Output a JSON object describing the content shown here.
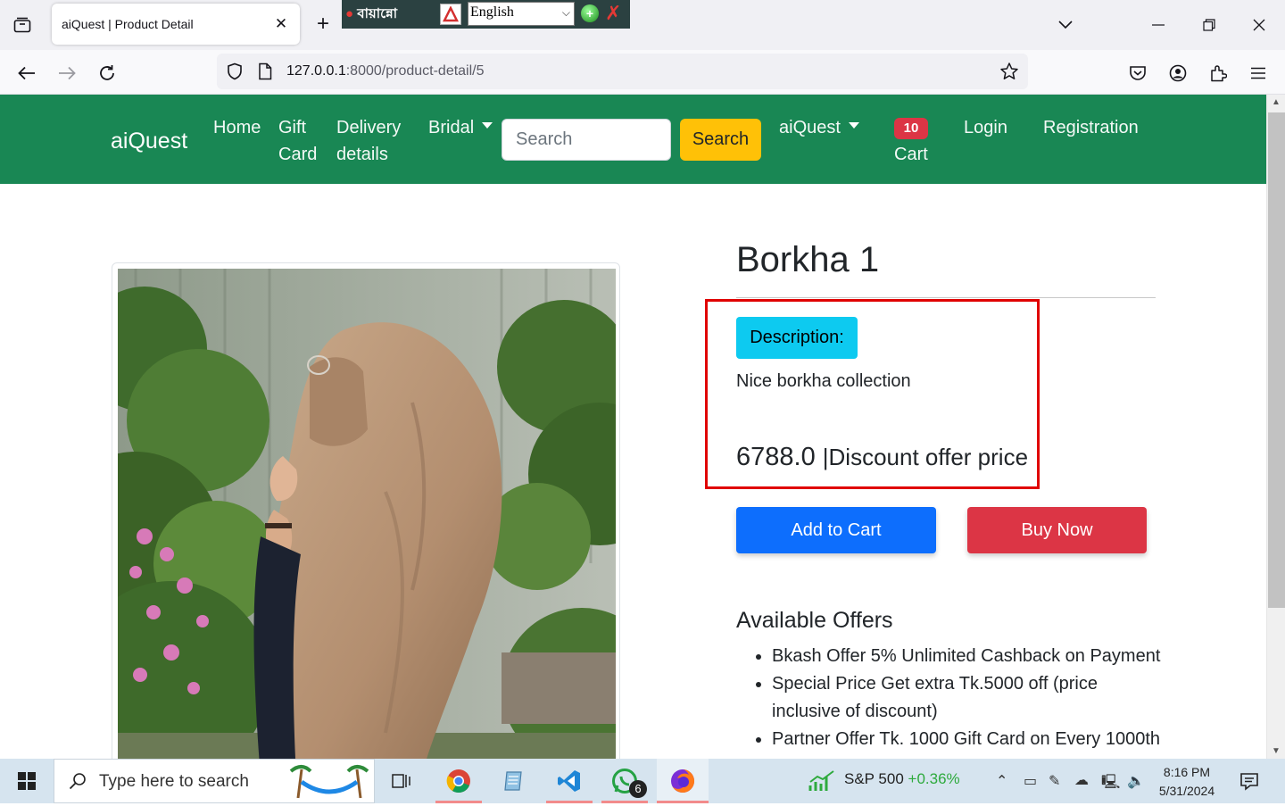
{
  "browser": {
    "tab_title": "aiQuest | Product Detail",
    "url_host": "127.0.0.1",
    "url_path": ":8000/product-detail/5"
  },
  "ime": {
    "bangla_label": "বায়ান্নো",
    "language": "English"
  },
  "site_nav": {
    "brand": "aiQuest",
    "links": [
      "Home",
      "Gift",
      "Card",
      "Delivery",
      "details",
      "Bridal"
    ],
    "search_placeholder": "Search",
    "search_button": "Search",
    "account_dropdown": "aiQuest",
    "cart_count": "10",
    "cart_label": "Cart",
    "login": "Login",
    "registration": "Registration"
  },
  "product": {
    "title": "Borkha 1",
    "description_label": "Description:",
    "description": "Nice borkha collection",
    "price": "6788.0",
    "price_note": "|Discount offer price",
    "add_to_cart": "Add to Cart",
    "buy_now": "Buy Now"
  },
  "offers": {
    "title": "Available Offers",
    "items": [
      "Bkash Offer 5% Unlimited Cashback on Payment",
      "Special Price Get extra Tk.5000 off (price inclusive of discount)",
      "Partner Offer Tk. 1000 Gift Card on Every 1000th"
    ]
  },
  "taskbar": {
    "search_placeholder": "Type here to search",
    "whatsapp_badge": "6",
    "ticker_name": "S&P 500",
    "ticker_change": "+0.36%",
    "time": "8:16 PM",
    "date": "5/31/2024"
  },
  "colors": {
    "nav_green": "#198754",
    "search_yellow": "#ffc107",
    "cart_badge_red": "#dc3545",
    "description_cyan": "#0dcaf0",
    "add_to_cart_blue": "#0d6efd",
    "buy_now_red": "#dc3545",
    "highlight_border": "#e00000"
  }
}
